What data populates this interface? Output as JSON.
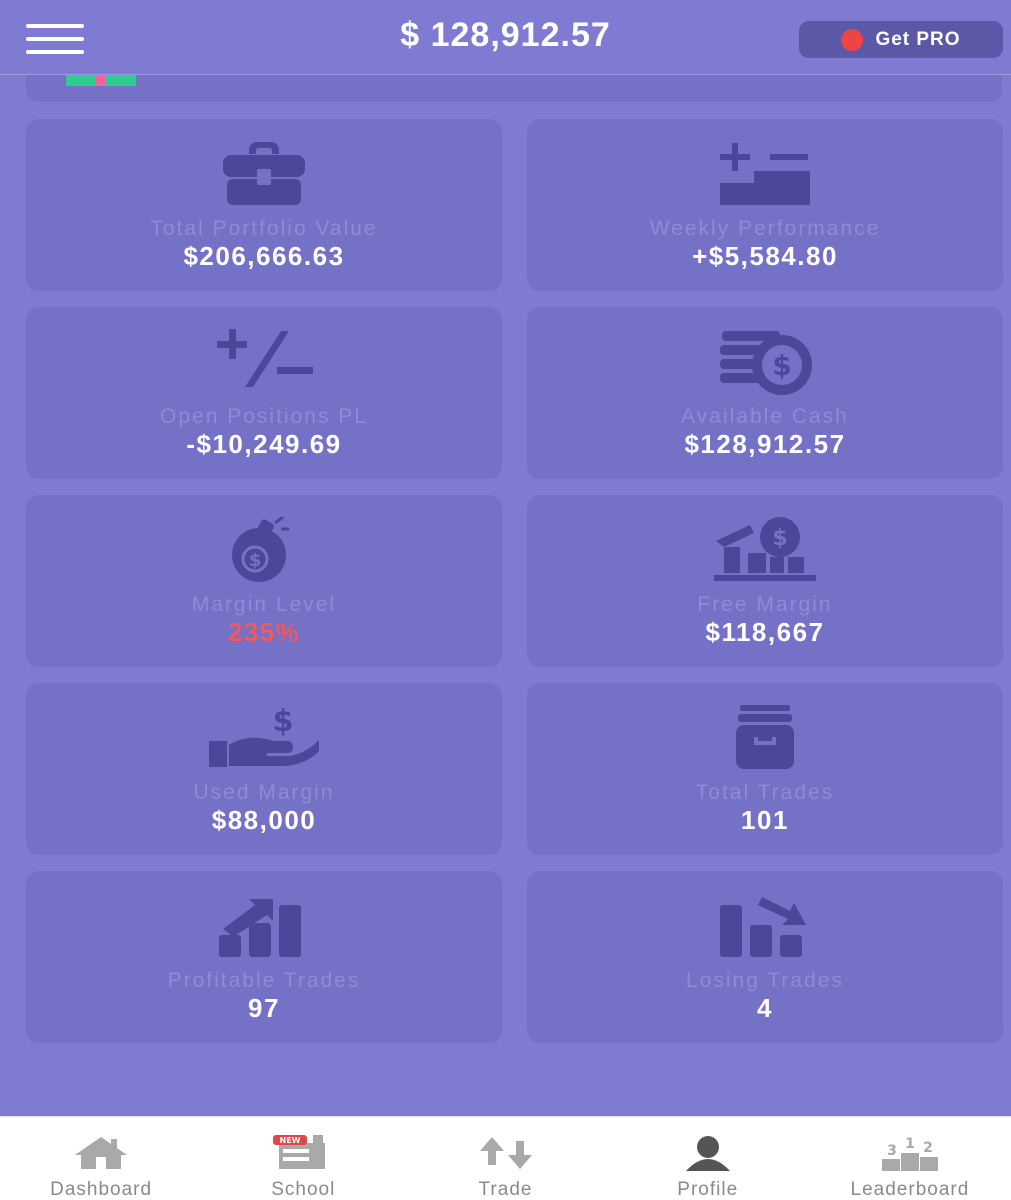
{
  "header": {
    "balance": "$ 128,912.57",
    "pro_label": "Get PRO"
  },
  "colors": {
    "background": "#7f7ad2",
    "card": "#7471c6",
    "icon": "#4b479a",
    "label": "#8f8bd8",
    "value": "#ffffff",
    "alert": "#f05a5a",
    "pro_dot": "#f04444"
  },
  "stats": [
    {
      "label": "Total Portfolio Value",
      "value": "$206,666.63",
      "icon": "briefcase-icon"
    },
    {
      "label": "Weekly Performance",
      "value": "+$5,584.80",
      "icon": "plus-minus-bars-icon"
    },
    {
      "label": "Open Positions PL",
      "value": "-$10,249.69",
      "icon": "plus-slash-minus-icon"
    },
    {
      "label": "Available Cash",
      "value": "$128,912.57",
      "icon": "coins-stack-icon"
    },
    {
      "label": "Margin Level",
      "value": "235%",
      "icon": "money-bomb-icon"
    },
    {
      "label": "Free Margin",
      "value": "$118,667",
      "icon": "dollar-podium-icon"
    },
    {
      "label": "Used Margin",
      "value": "$88,000",
      "icon": "hand-dollar-icon"
    },
    {
      "label": "Total Trades",
      "value": "101",
      "icon": "archive-box-icon"
    },
    {
      "label": "Profitable Trades",
      "value": "97",
      "icon": "chart-up-icon"
    },
    {
      "label": "Losing Trades",
      "value": "4",
      "icon": "chart-down-icon"
    }
  ],
  "nav": {
    "items": [
      {
        "label": "Dashboard",
        "icon": "home-icon"
      },
      {
        "label": "School",
        "icon": "school-new-icon",
        "badge": "NEW"
      },
      {
        "label": "Trade",
        "icon": "swap-arrows-icon"
      },
      {
        "label": "Profile",
        "icon": "user-icon"
      },
      {
        "label": "Leaderboard",
        "icon": "podium-icon"
      }
    ]
  }
}
